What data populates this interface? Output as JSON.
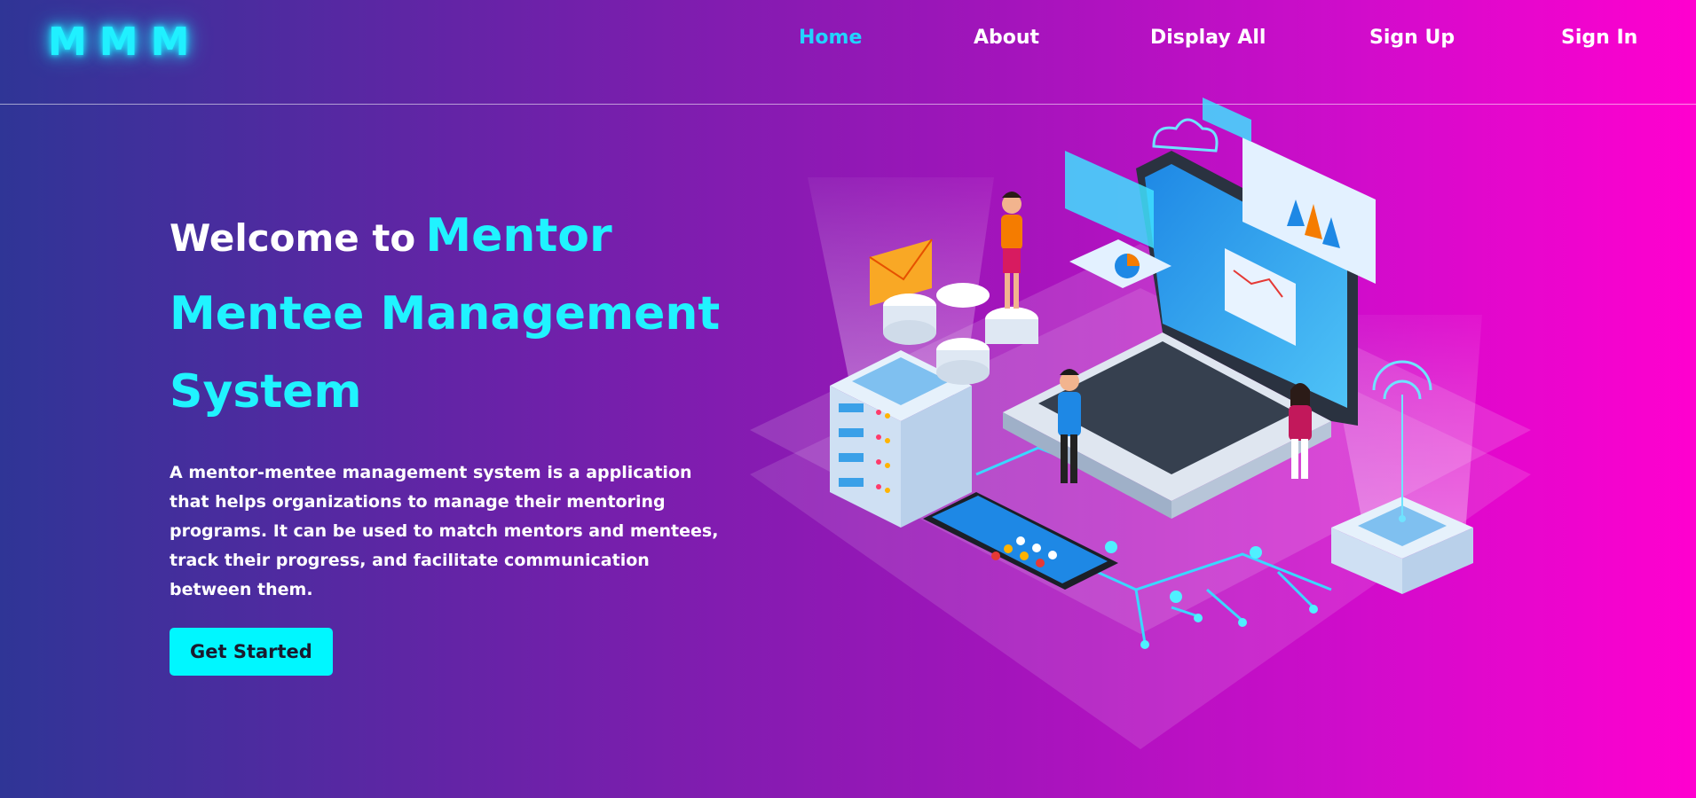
{
  "brand": {
    "logo_text": "MMM"
  },
  "nav": {
    "items": [
      {
        "label": "Home",
        "active": true
      },
      {
        "label": "About",
        "active": false
      },
      {
        "label": "Display All",
        "active": false
      },
      {
        "label": "Sign Up",
        "active": false
      },
      {
        "label": "Sign In",
        "active": false
      }
    ]
  },
  "hero": {
    "title_prefix": "Welcome to",
    "title_highlight": "Mentor Mentee Management System",
    "description": "A mentor-mentee management system is a application that helps organizations to manage their mentoring programs. It can be used to match mentors and mentees, track their progress, and facilitate communication between them.",
    "cta_label": "Get Started"
  },
  "colors": {
    "accent_cyan": "#20f3ff",
    "nav_active": "#22d3ff",
    "bg_left": "#2f3596",
    "bg_right": "#ff00cf",
    "button_bg": "#00f7ff"
  },
  "illustration": {
    "icon": "isometric-mentoring-tech-illustration"
  }
}
